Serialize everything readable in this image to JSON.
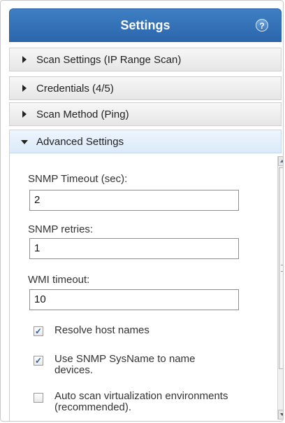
{
  "header": {
    "title": "Settings",
    "help_icon": "help-icon",
    "help_glyph": "?"
  },
  "accent_color": "#2b66ad",
  "sections": [
    {
      "label": "Scan Settings (IP Range Scan)",
      "expanded": false
    },
    {
      "label": "Credentials (4/5)",
      "expanded": false
    },
    {
      "label": "Scan Method (Ping)",
      "expanded": false
    },
    {
      "label": "Advanced Settings",
      "expanded": true
    }
  ],
  "advanced": {
    "snmp_timeout": {
      "label": "SNMP Timeout (sec):",
      "value": "2"
    },
    "snmp_retries": {
      "label": "SNMP retries:",
      "value": "1"
    },
    "wmi_timeout": {
      "label": "WMI timeout:",
      "value": "10"
    },
    "checkboxes": [
      {
        "line1": "Resolve host names",
        "line2": "",
        "checked": true
      },
      {
        "line1": "Use SNMP SysName to name",
        "line2": "devices.",
        "checked": true
      },
      {
        "line1": "Auto scan virtualization environments",
        "line2": "(recommended).",
        "checked": false
      }
    ]
  }
}
